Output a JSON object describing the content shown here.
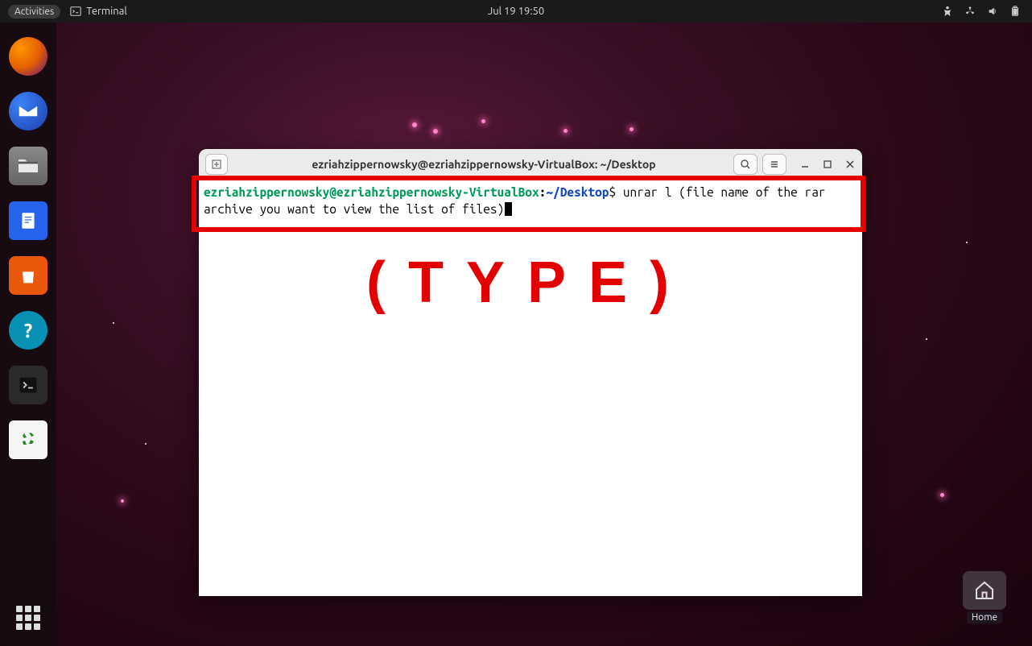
{
  "topbar": {
    "activities": "Activities",
    "app_name": "Terminal",
    "datetime": "Jul 19  19:50"
  },
  "dock": {
    "help_glyph": "?"
  },
  "terminal": {
    "title": "ezriahzippernowsky@ezriahzippernowsky-VirtualBox: ~/Desktop",
    "prompt_user": "ezriahzippernowsky@ezriahzippernowsky-VirtualBox",
    "prompt_colon": ":",
    "prompt_path": "~/Desktop",
    "prompt_dollar": "$",
    "command": " unrar l (file name of the rar archive you want to view the list of files)"
  },
  "annotation": {
    "type_label": "(TYPE)"
  },
  "desktop": {
    "home_label": "Home"
  }
}
